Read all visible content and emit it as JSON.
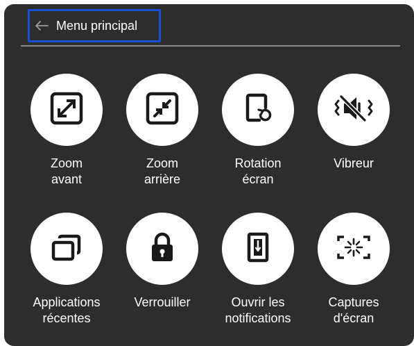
{
  "header": {
    "title": "Menu principal",
    "back_icon": "arrow-left-icon"
  },
  "colors": {
    "panel_bg": "#2d2d2d",
    "focus_border": "#1a4fd8",
    "circle_bg": "#ffffff",
    "icon_color": "#1a1a1a"
  },
  "tiles": [
    {
      "line1": "Zoom",
      "line2": "avant",
      "icon": "zoom-in-icon"
    },
    {
      "line1": "Zoom",
      "line2": "arrière",
      "icon": "zoom-out-icon"
    },
    {
      "line1": "Rotation",
      "line2": "écran",
      "icon": "rotate-screen-icon"
    },
    {
      "line1": "Vibreur",
      "line2": "",
      "icon": "vibrate-icon"
    },
    {
      "line1": "Applications",
      "line2": "récentes",
      "icon": "recent-apps-icon"
    },
    {
      "line1": "Verrouiller",
      "line2": "",
      "icon": "lock-icon"
    },
    {
      "line1": "Ouvrir les",
      "line2": "notifications",
      "icon": "notifications-icon"
    },
    {
      "line1": "Captures",
      "line2": "d'écran",
      "icon": "screenshot-icon"
    }
  ]
}
